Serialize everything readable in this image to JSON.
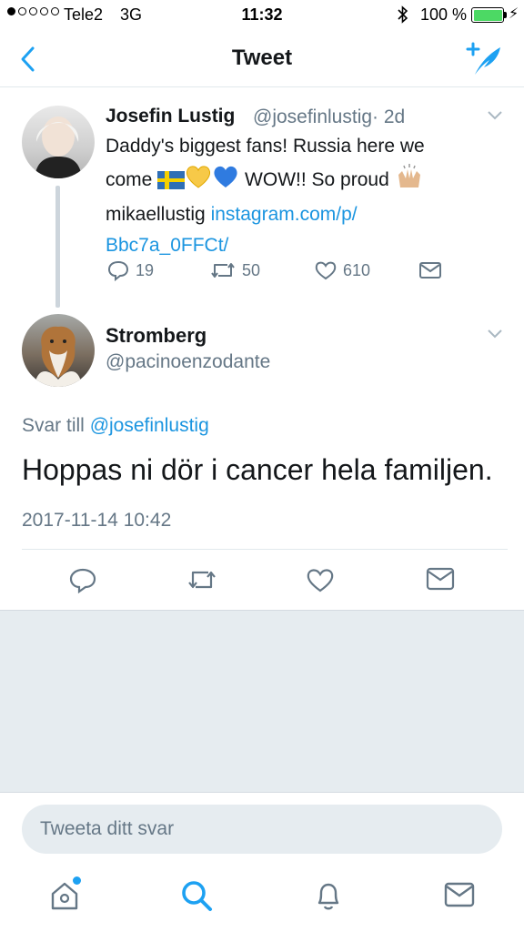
{
  "status_bar": {
    "carrier": "Tele2",
    "network": "3G",
    "time": "11:32",
    "battery_percent": "100 %",
    "signal_strength": 1,
    "icons": [
      "signal-dots-icon",
      "bluetooth-icon",
      "battery-icon",
      "charging-bolt-icon"
    ]
  },
  "nav": {
    "title": "Tweet",
    "back_icon": "chevron-left-icon",
    "compose_icon": "compose-quill-icon"
  },
  "parent_tweet": {
    "name": "Josefin Lustig",
    "handle": "@josefinlustig",
    "age": "· 2d",
    "text_line1": "Daddy's biggest fans! Russia here we",
    "text_line2_a": "come",
    "text_line2_b": "WOW!! So proud",
    "text_line3_a": "mikaellustig",
    "link_line3": "instagram.com/p/",
    "link_line4": "Bbc7a_0FFCt/",
    "replies": "19",
    "retweets": "50",
    "likes": "610"
  },
  "main_tweet": {
    "name": "Stromberg",
    "handle": "@pacinoenzodante",
    "reply_prefix": "Svar till",
    "reply_handle": "@josefinlustig",
    "text": "Hoppas ni dör i cancer hela familjen.",
    "timestamp": "2017-11-14 10:42"
  },
  "reply_bar": {
    "placeholder": "Tweeta ditt svar"
  },
  "tabs": [
    "home-icon",
    "search-icon",
    "notifications-bell-icon",
    "messages-envelope-icon"
  ],
  "colors": {
    "accent": "#1da1f2",
    "link": "#1b95e0",
    "secondary_text": "#657786",
    "background_gray": "#e6ecf0"
  }
}
